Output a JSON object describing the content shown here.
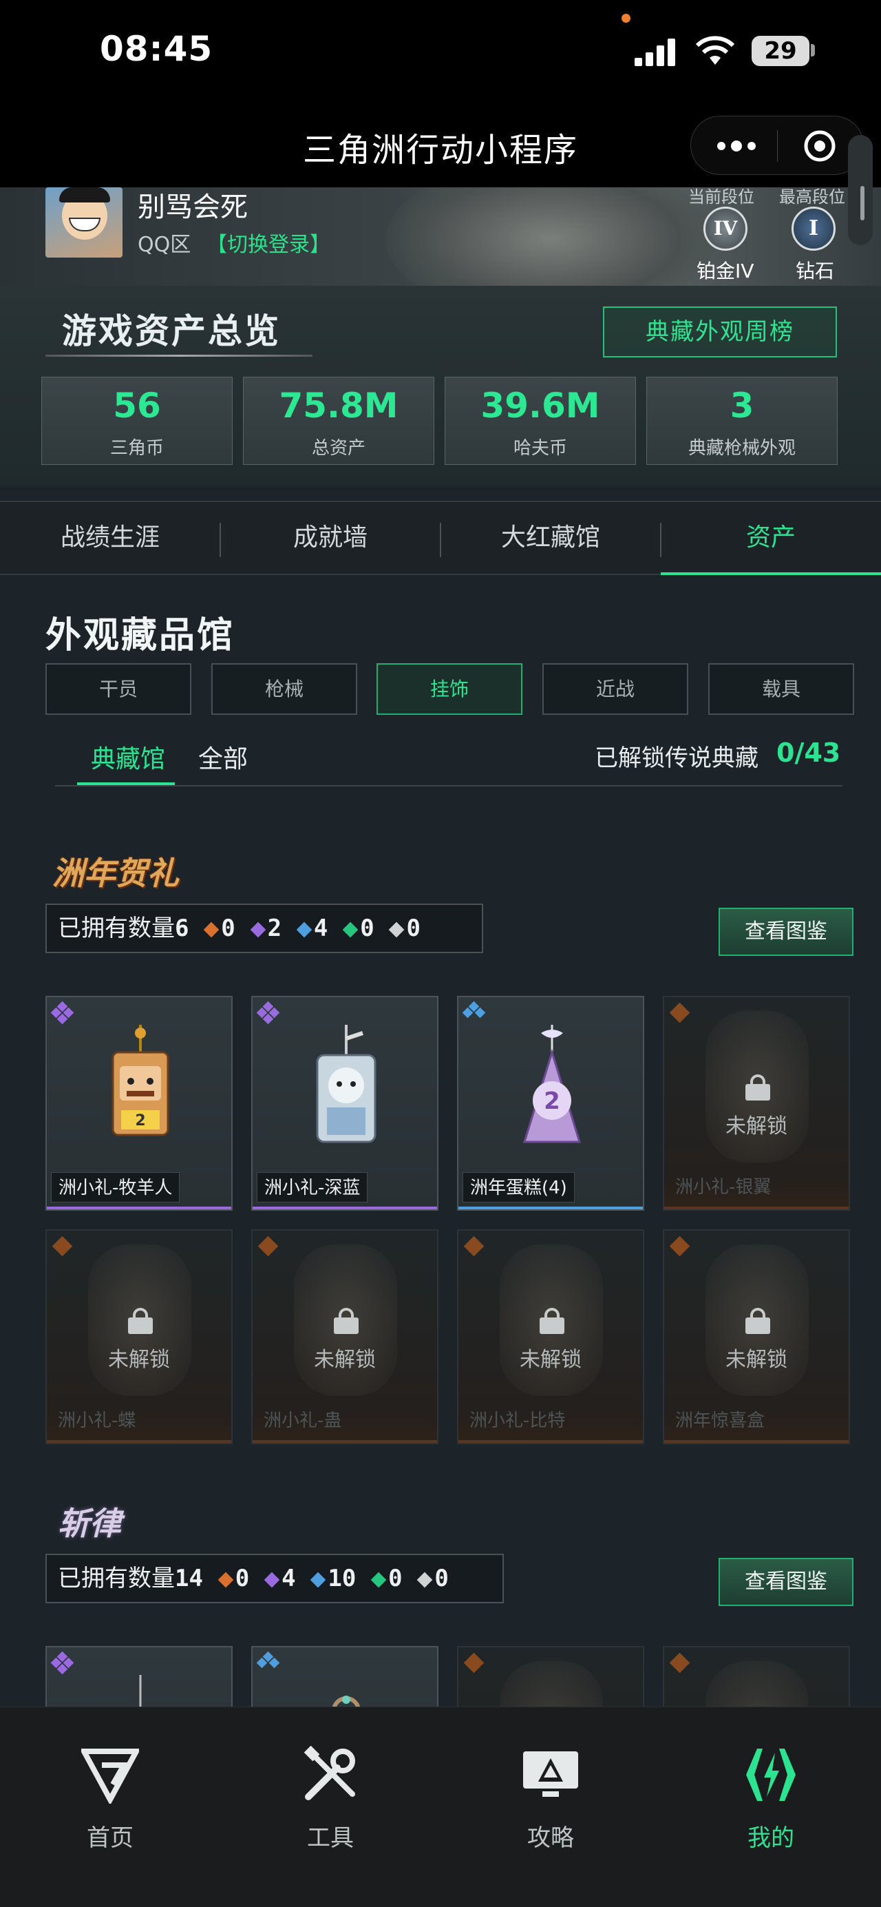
{
  "status_bar": {
    "time": "08:45",
    "battery": "29"
  },
  "nav": {
    "title": "三角洲行动小程序",
    "more_icon": "more-dots-icon",
    "close_icon": "target-circle-icon"
  },
  "profile": {
    "username": "别骂会死",
    "zone": "QQ区",
    "switch_login": "【切换登录】",
    "rank_head_left": "当前段位",
    "rank_head_right": "最高段位",
    "rank_current": {
      "numeral": "IV",
      "label": "铂金IV"
    },
    "rank_highest": {
      "numeral": "I",
      "label": "钻石"
    }
  },
  "overview": {
    "title": "游戏资产总览",
    "weekly_button": "典藏外观周榜",
    "stats": [
      {
        "value": "56",
        "label": "三角币"
      },
      {
        "value": "75.8M",
        "label": "总资产"
      },
      {
        "value": "39.6M",
        "label": "哈夫币"
      },
      {
        "value": "3",
        "label": "典藏枪械外观"
      }
    ]
  },
  "tabs": [
    {
      "label": "战绩生涯"
    },
    {
      "label": "成就墙"
    },
    {
      "label": "大红藏馆"
    },
    {
      "label": "资产",
      "active": true
    }
  ],
  "gallery": {
    "title": "外观藏品馆",
    "categories": [
      "干员",
      "枪械",
      "挂饰",
      "近战",
      "载具"
    ],
    "active_category": "挂饰",
    "subtabs": [
      "典藏馆",
      "全部"
    ],
    "legend_label": "已解锁传说典藏",
    "legend_count": "0/43"
  },
  "series": [
    {
      "logo": "洲年贺礼",
      "owned_label": "已拥有数量",
      "owned_total": "6",
      "counts": [
        "0",
        "2",
        "4",
        "0",
        "0"
      ],
      "view_button": "查看图鉴",
      "items": [
        {
          "name": "洲小礼-牧羊人",
          "rarity": "purple",
          "locked": false
        },
        {
          "name": "洲小礼-深蓝",
          "rarity": "purple",
          "locked": false
        },
        {
          "name": "洲年蛋糕(4)",
          "rarity": "blue",
          "locked": false
        },
        {
          "name": "洲小礼-银翼",
          "rarity": "orange",
          "locked": true
        },
        {
          "name": "洲小礼-蝶",
          "rarity": "orange",
          "locked": true
        },
        {
          "name": "洲小礼-蛊",
          "rarity": "orange",
          "locked": true
        },
        {
          "name": "洲小礼-比特",
          "rarity": "orange",
          "locked": true
        },
        {
          "name": "洲年惊喜盒",
          "rarity": "orange",
          "locked": true
        }
      ]
    },
    {
      "logo": "斩律",
      "owned_label": "已拥有数量",
      "owned_total": "14",
      "counts": [
        "0",
        "4",
        "10",
        "0",
        "0"
      ],
      "view_button": "查看图鉴",
      "items": [
        {
          "rarity": "purple",
          "locked": false
        },
        {
          "rarity": "blue",
          "locked": false
        },
        {
          "rarity": "orange",
          "locked": true
        },
        {
          "rarity": "orange",
          "locked": true
        }
      ]
    }
  ],
  "lock_text": "未解锁",
  "bottom_nav": [
    {
      "label": "首页",
      "icon": "delta-logo-icon"
    },
    {
      "label": "工具",
      "icon": "tools-icon"
    },
    {
      "label": "攻略",
      "icon": "monitor-guide-icon"
    },
    {
      "label": "我的",
      "icon": "mine-logo-icon",
      "active": true
    }
  ],
  "colors": {
    "accent": "#2be391",
    "orange": "#d9702e",
    "purple": "#9a6be0",
    "blue": "#4d9fe0",
    "green": "#25c77f",
    "gray": "#cfd3d4"
  }
}
